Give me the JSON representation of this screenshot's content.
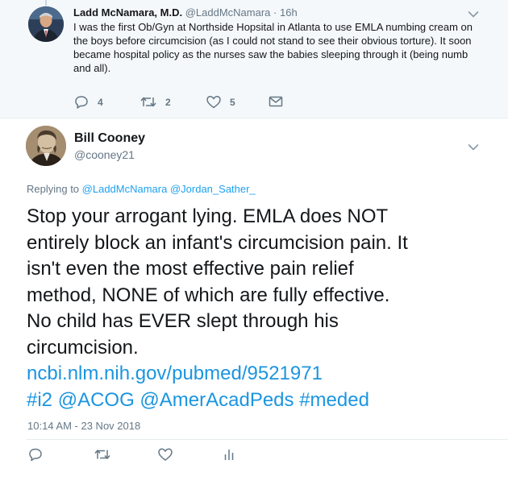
{
  "parent_tweet": {
    "author_name": "Ladd McNamara, M.D.",
    "author_handle": "@LaddMcNamara",
    "dot": "·",
    "time": "16h",
    "text": "I was the first Ob/Gyn at Northside Hopsital in Atlanta to use EMLA numbing cream on the boys before circumcision (as I could not stand to see their obvious torture).  It soon became hospital policy as the nurses saw the babies sleeping through it (being numb and all).",
    "reply_count": "4",
    "retweet_count": "2",
    "like_count": "5",
    "icons": [
      "reply-icon",
      "retweet-icon",
      "like-icon",
      "message-icon",
      "chevron-down-icon"
    ]
  },
  "main_tweet": {
    "author_name": "Bill Cooney",
    "author_handle": "@cooney21",
    "replying_prefix": "Replying to ",
    "replying_to": [
      "@LaddMcNamara",
      "@Jordan_Sather_"
    ],
    "text_lines": [
      "Stop your arrogant lying. EMLA does NOT",
      "entirely block an infant's circumcision pain. It",
      "isn't even the most effective pain relief",
      "method, NONE of which are fully effective.",
      "No child has EVER slept through his",
      "circumcision."
    ],
    "link": "ncbi.nlm.nih.gov/pubmed/9521971",
    "tags": [
      "#i2",
      "@ACOG",
      "@AmerAcadPeds",
      "#meded"
    ],
    "timestamp": "10:14 AM - 23 Nov 2018",
    "icons": [
      "reply-icon",
      "retweet-icon",
      "like-icon",
      "analytics-icon",
      "chevron-down-icon"
    ]
  },
  "colors": {
    "link": "#1b95e0",
    "muted": "#657786",
    "text": "#14171a",
    "parent_background": "#f5f8fa"
  }
}
